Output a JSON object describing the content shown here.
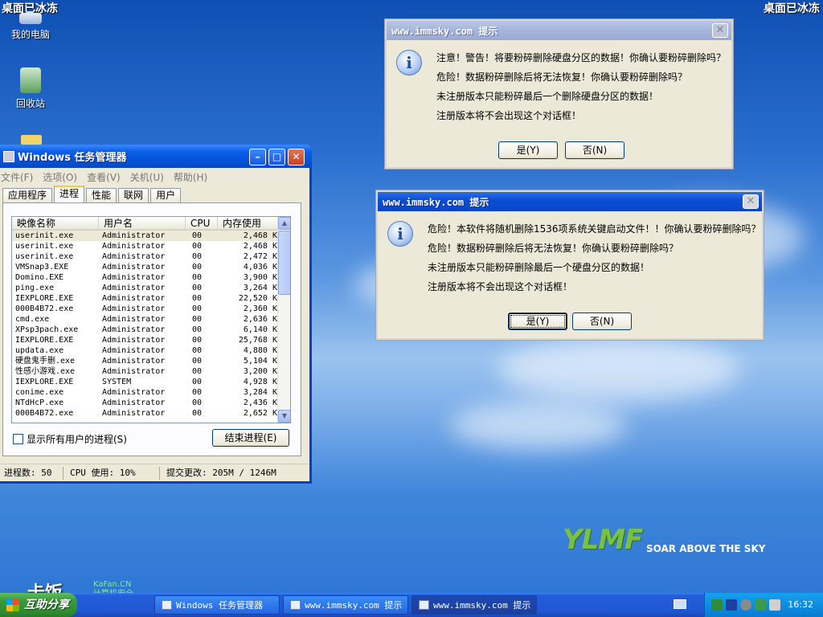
{
  "desktop": {
    "corner_label": "桌面已冰冻",
    "icons": [
      {
        "label": "我的电脑",
        "icon": "computer-icon"
      },
      {
        "label": "回收站",
        "icon": "recycle-bin-icon"
      }
    ]
  },
  "dialog1": {
    "title": "www.immsky.com  提示",
    "lines": [
      "注意！警告！将要粉碎删除硬盘分区的数据！你确认要粉碎删除吗？",
      "危险！数据粉碎删除后将无法恢复！你确认要粉碎删除吗？",
      "未注册版本只能粉碎最后一个删除硬盘分区的数据！",
      "注册版本将不会出现这个对话框！"
    ],
    "yes": "是(Y)",
    "no": "否(N)"
  },
  "dialog2": {
    "title": "www.immsky.com  提示",
    "lines": [
      "危险！本软件将随机删除1536项系统关键启动文件！！你确认要粉碎删除吗？",
      "危险！数据粉碎删除后将无法恢复！你确认要粉碎删除吗？",
      "未注册版本只能粉碎删除最后一个硬盘分区的数据！",
      "注册版本将不会出现这个对话框！"
    ],
    "yes": "是(Y)",
    "no": "否(N)"
  },
  "task_manager": {
    "title": "Windows 任务管理器",
    "menu": [
      "文件(F)",
      "选项(O)",
      "查看(V)",
      "关机(U)",
      "帮助(H)"
    ],
    "tabs": [
      "应用程序",
      "进程",
      "性能",
      "联网",
      "用户"
    ],
    "selected_tab": "进程",
    "columns": [
      "映像名称",
      "用户名",
      "CPU",
      "内存使用"
    ],
    "rows": [
      [
        "userinit.exe",
        "Administrator",
        "00",
        "2,468 K"
      ],
      [
        "userinit.exe",
        "Administrator",
        "00",
        "2,468 K"
      ],
      [
        "userinit.exe",
        "Administrator",
        "00",
        "2,472 K"
      ],
      [
        "VMSnap3.EXE",
        "Administrator",
        "00",
        "4,036 K"
      ],
      [
        "Domino.EXE",
        "Administrator",
        "00",
        "3,900 K"
      ],
      [
        "ping.exe",
        "Administrator",
        "00",
        "3,264 K"
      ],
      [
        "IEXPLORE.EXE",
        "Administrator",
        "00",
        "22,520 K"
      ],
      [
        "000B4B72.exe",
        "Administrator",
        "00",
        "2,360 K"
      ],
      [
        "cmd.exe",
        "Administrator",
        "00",
        "2,636 K"
      ],
      [
        "XPsp3pach.exe",
        "Administrator",
        "00",
        "6,140 K"
      ],
      [
        "IEXPLORE.EXE",
        "Administrator",
        "00",
        "25,768 K"
      ],
      [
        "updata.exe",
        "Administrator",
        "00",
        "4,880 K"
      ],
      [
        "硬盘鬼手删.exe",
        "Administrator",
        "00",
        "5,104 K"
      ],
      [
        "性感小游戏.exe",
        "Administrator",
        "00",
        "3,200 K"
      ],
      [
        "IEXPLORE.EXE",
        "SYSTEM",
        "00",
        "4,928 K"
      ],
      [
        "conime.exe",
        "Administrator",
        "00",
        "3,284 K"
      ],
      [
        "NTdHcP.exe",
        "Administrator",
        "00",
        "2,436 K"
      ],
      [
        "000B4B72.exe",
        "Administrator",
        "00",
        "2,652 K"
      ]
    ],
    "show_all_users": "显示所有用户的进程(S)",
    "end_process": "结束进程(E)",
    "status": {
      "processes": "进程数: 50",
      "cpu": "CPU 使用: 10%",
      "commit": "提交更改: 205M / 1246M"
    }
  },
  "logo": {
    "brand": "YLMF",
    "tagline": "SOAR ABOVE THE SKY"
  },
  "watermark": {
    "brand": "卡饭",
    "site": "KaFan.CN",
    "slogan": "计算机安全"
  },
  "taskbar": {
    "start": "互助分享",
    "items": [
      {
        "label": "Windows 任务管理器",
        "active": false
      },
      {
        "label": "www.immsky.com 提示",
        "active": false
      },
      {
        "label": "www.immsky.com 提示",
        "active": true
      }
    ],
    "clock": "16:32"
  }
}
